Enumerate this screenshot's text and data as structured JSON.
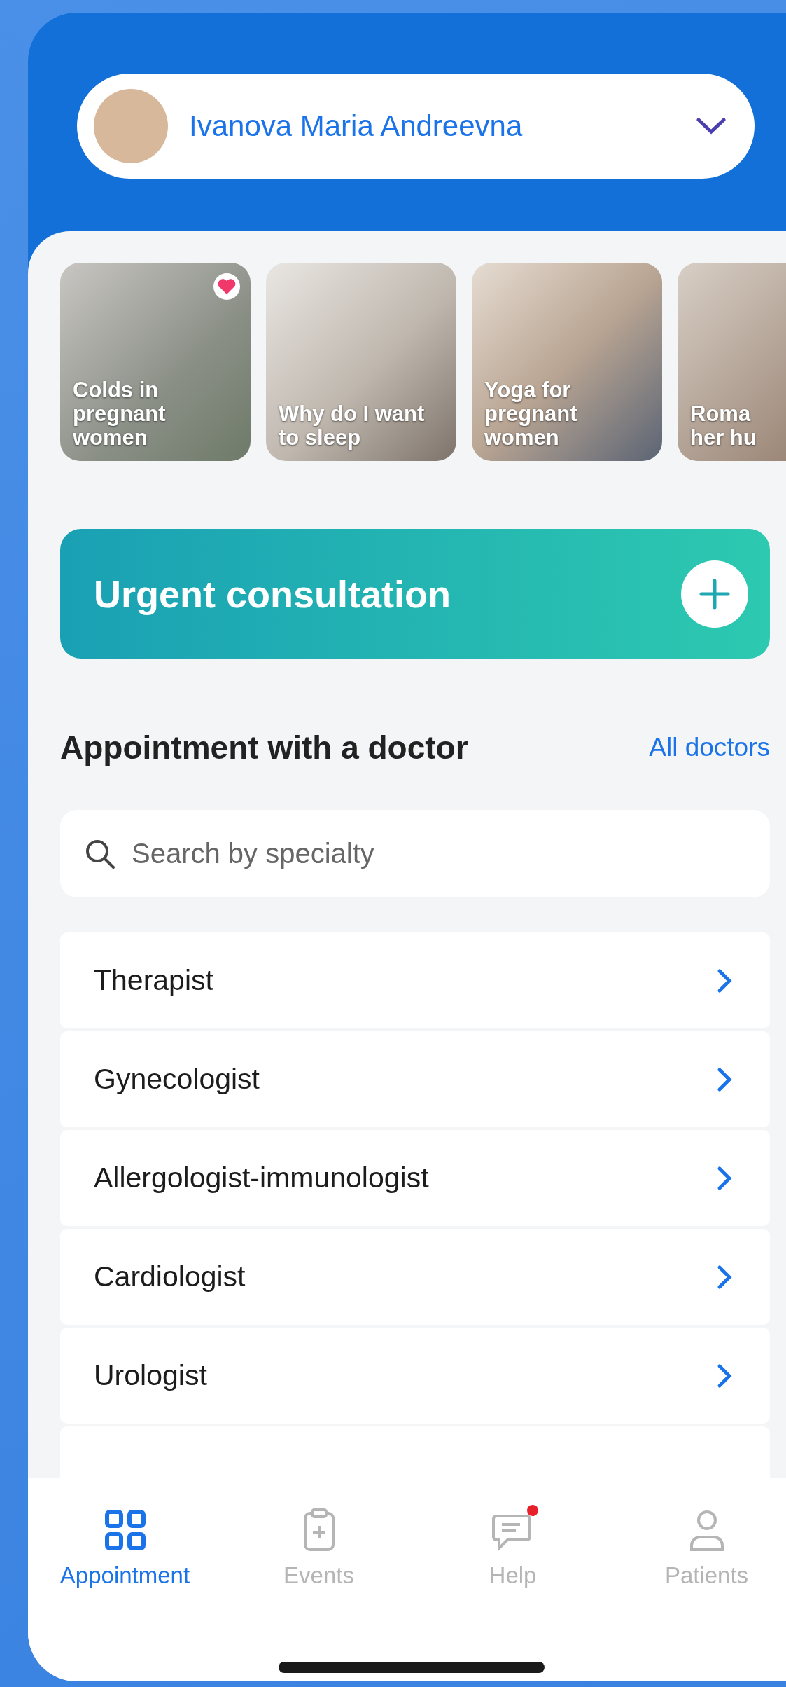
{
  "profile": {
    "name": "Ivanova Maria Andreevna"
  },
  "stories": [
    {
      "title": "Colds in pregnant women",
      "favorite": true
    },
    {
      "title": "Why do I want to sleep",
      "favorite": false
    },
    {
      "title": "Yoga for pregnant women",
      "favorite": false
    },
    {
      "title": "Roma her hu",
      "favorite": false
    }
  ],
  "urgent": {
    "label": "Urgent consultation"
  },
  "section": {
    "title": "Appointment with a doctor",
    "link": "All doctors"
  },
  "search": {
    "placeholder": "Search by specialty"
  },
  "specialties": [
    "Therapist",
    "Gynecologist",
    "Allergologist-immunologist",
    "Cardiologist",
    "Urologist"
  ],
  "nav": [
    {
      "label": "Appointment",
      "selected": true,
      "notification": false
    },
    {
      "label": "Events",
      "selected": false,
      "notification": false
    },
    {
      "label": "Help",
      "selected": false,
      "notification": true
    },
    {
      "label": "Patients",
      "selected": false,
      "notification": false
    }
  ]
}
